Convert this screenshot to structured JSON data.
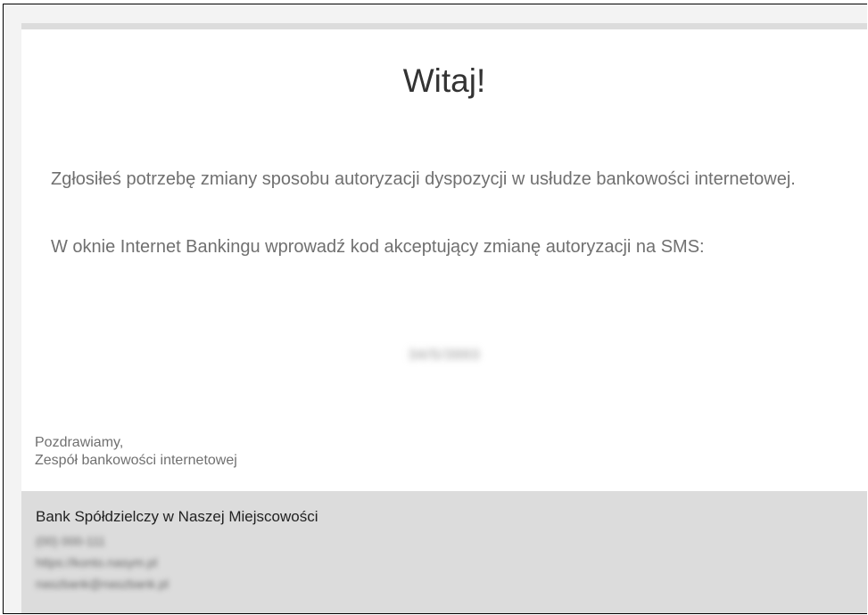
{
  "email": {
    "greeting": "Witaj!",
    "paragraph_1": "Zgłosiłeś potrzebę zmiany sposobu autoryzacji dyspozycji w usłudze bankowości internetowej.",
    "paragraph_2": "W oknie Internet Bankingu wprowadź kod akceptujący zmianę autoryzacji na SMS:",
    "code": "34/5/3993",
    "signoff_line_1": "Pozdrawiamy,",
    "signoff_line_2": "Zespół bankowości internetowej"
  },
  "footer": {
    "bank_name": "Bank Spółdzielczy w Naszej Miejscowości",
    "phone": "(00) 000-111",
    "website": "https://konto.nasym.pl",
    "email": "naszbank@naszbank.pl"
  },
  "colors": {
    "footer_background": "#dcdcdc",
    "body_background": "#ffffff",
    "text_gray": "#707070"
  }
}
